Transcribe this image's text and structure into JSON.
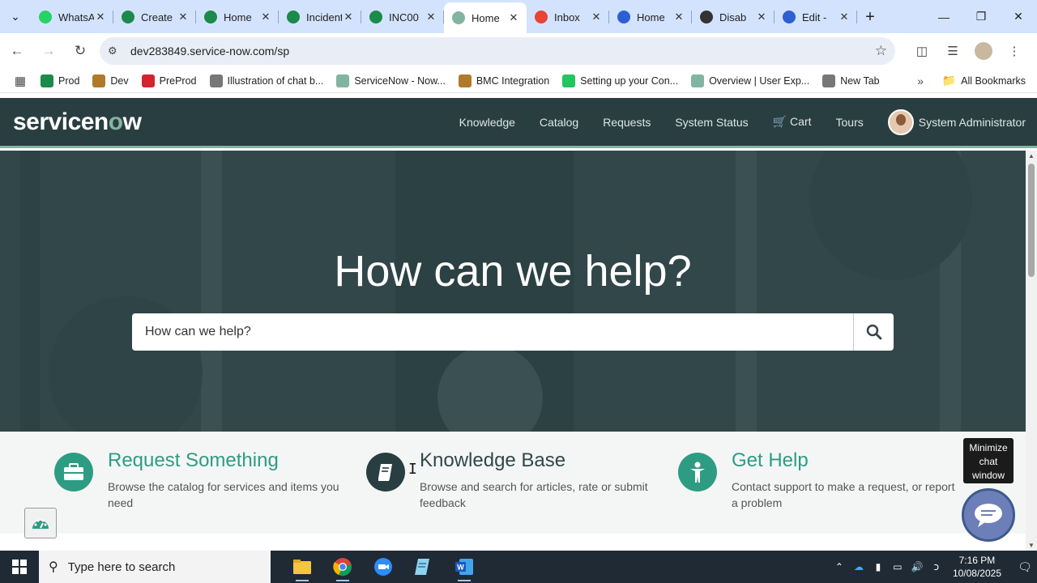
{
  "browser": {
    "tabs": [
      {
        "title": "WhatsApp",
        "icon": "whatsapp-icon",
        "color": "#25d366"
      },
      {
        "title": "Create",
        "icon": "servicenow-icon",
        "color": "#1b8a4a"
      },
      {
        "title": "Home",
        "icon": "servicenow-icon",
        "color": "#1b8a4a"
      },
      {
        "title": "Incident",
        "icon": "servicenow-icon",
        "color": "#1b8a4a"
      },
      {
        "title": "INC00",
        "icon": "servicenow-icon",
        "color": "#1b8a4a"
      },
      {
        "title": "Home",
        "icon": "servicenow-portal-icon",
        "color": "#81b5a1",
        "active": true
      },
      {
        "title": "Inbox",
        "icon": "gmail-icon",
        "color": "#ea4335"
      },
      {
        "title": "Home",
        "icon": "zoom-icon",
        "color": "#2d5fd3"
      },
      {
        "title": "Disab",
        "icon": "chatgpt-icon",
        "color": "#333333"
      },
      {
        "title": "Edit -",
        "icon": "zoom-icon",
        "color": "#2d5fd3"
      }
    ],
    "url": "dev283849.service-now.com/sp",
    "bookmarks": [
      {
        "label": "Prod",
        "icon": "servicenow-icon",
        "color": "#1b8a4a"
      },
      {
        "label": "Dev",
        "icon": "arch-icon",
        "color": "#b07a2a"
      },
      {
        "label": "PreProd",
        "icon": "preprod-icon",
        "color": "#d1242f"
      },
      {
        "label": "Illustration of chat b...",
        "icon": "globe-icon",
        "color": "#777777"
      },
      {
        "label": "ServiceNow - Now...",
        "icon": "servicenow-portal-icon",
        "color": "#81b5a1"
      },
      {
        "label": "BMC Integration",
        "icon": "arch-icon",
        "color": "#b07a2a"
      },
      {
        "label": "Setting up your Con...",
        "icon": "leaf-icon",
        "color": "#22c55e"
      },
      {
        "label": "Overview | User Exp...",
        "icon": "servicenow-portal-icon",
        "color": "#81b5a1"
      },
      {
        "label": "New Tab",
        "icon": "globe-icon",
        "color": "#777777"
      }
    ],
    "all_bookmarks": "All Bookmarks"
  },
  "portal": {
    "logo_prefix": "servicen",
    "logo_o": "o",
    "logo_suffix": "w",
    "nav": {
      "knowledge": "Knowledge",
      "catalog": "Catalog",
      "requests": "Requests",
      "system_status": "System Status",
      "cart": "Cart",
      "tours": "Tours"
    },
    "user": "System Administrator",
    "hero_title": "How can we help?",
    "search_placeholder": "How can we help?",
    "features": {
      "request": {
        "title": "Request Something",
        "desc": "Browse the catalog for services and items you need"
      },
      "knowledge": {
        "title": "Knowledge Base",
        "desc": "Browse and search for articles, rate or submit feedback"
      },
      "help": {
        "title": "Get Help",
        "desc": "Contact support to make a request, or report a problem"
      }
    },
    "chat_tooltip": "Minimize chat window",
    "colors": {
      "header": "#293e40",
      "accent": "#81b5a1",
      "hero": "#32474a",
      "feature_green": "#2e9c82"
    }
  },
  "taskbar": {
    "search_placeholder": "Type here to search",
    "time": "7:16 PM",
    "date": "10/08/2025"
  }
}
